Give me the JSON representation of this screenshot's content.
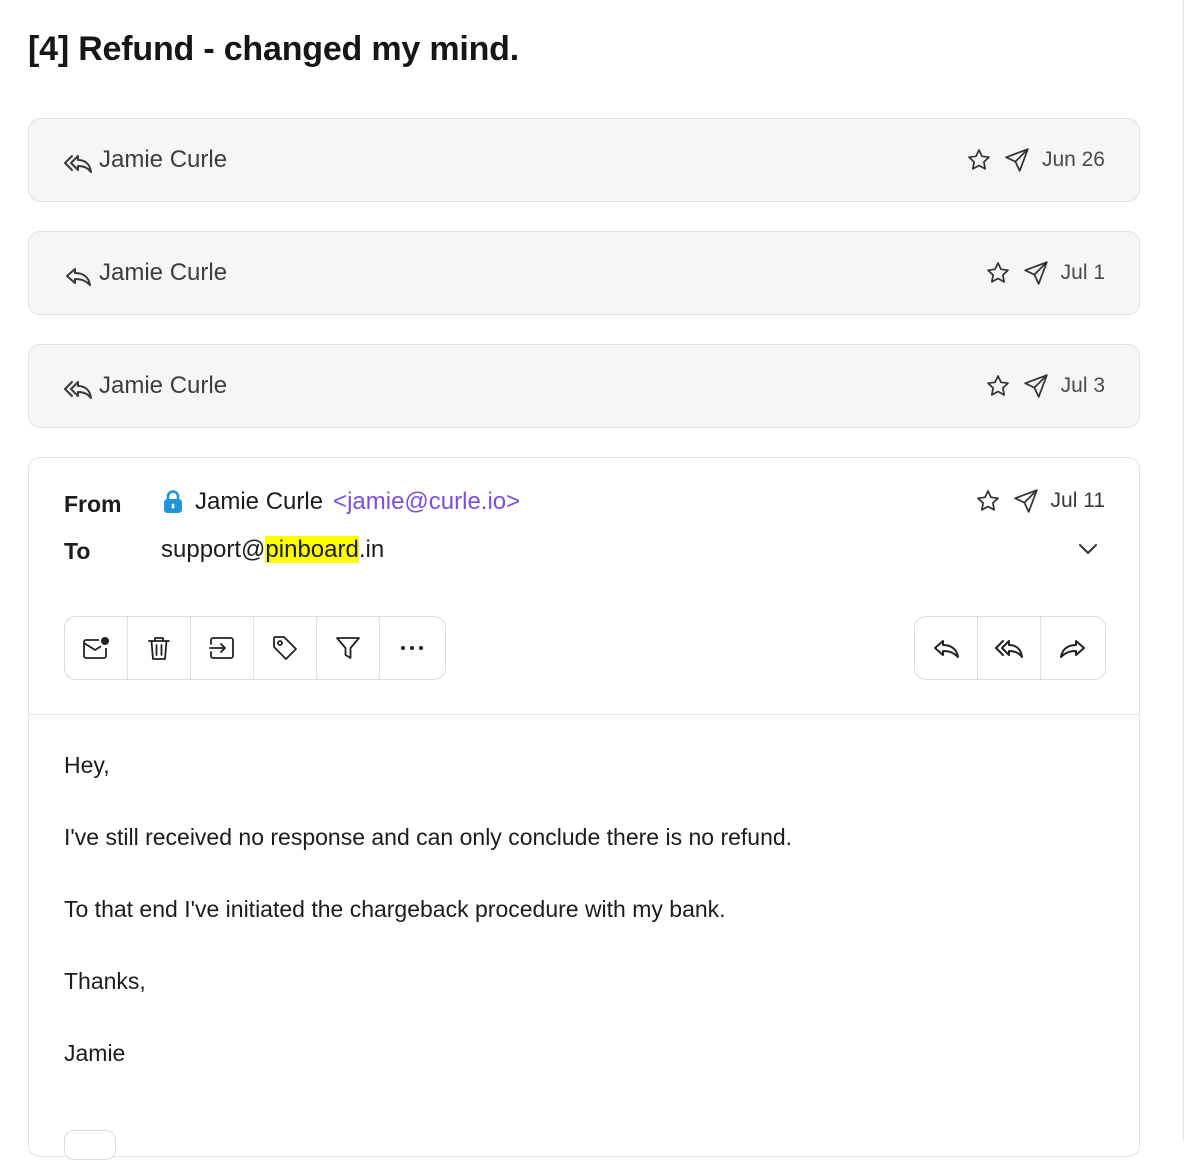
{
  "thread": {
    "subject": "[4] Refund - changed my mind."
  },
  "collapsed_messages": [
    {
      "sender": "Jamie Curle",
      "date": "Jun 26",
      "reply_icon": "reply-all-icon"
    },
    {
      "sender": "Jamie Curle",
      "date": "Jul 1",
      "reply_icon": "reply-icon"
    },
    {
      "sender": "Jamie Curle",
      "date": "Jul 3",
      "reply_icon": "reply-all-icon"
    }
  ],
  "open_message": {
    "from_label": "From",
    "to_label": "To",
    "from_name": "Jamie Curle",
    "from_email": "<jamie@curle.io>",
    "to_prefix": "support@",
    "to_highlight": "pinboard",
    "to_suffix": ".in",
    "date": "Jul 11",
    "body": [
      "Hey,",
      "I've still received no response and can only conclude there is no refund.",
      "To that end I've initiated the chargeback procedure with my bank.",
      "Thanks,",
      "Jamie"
    ]
  },
  "toolbar": {
    "left": [
      "mark-unread-icon",
      "trash-icon",
      "move-to-icon",
      "tag-icon",
      "filter-icon",
      "more-icon"
    ],
    "right": [
      "reply-icon",
      "reply-all-icon",
      "forward-icon"
    ]
  },
  "icons": {
    "star": "star-icon",
    "sent": "sent-icon",
    "lock": "lock-icon",
    "expand": "chevron-down-icon"
  },
  "colors": {
    "email_link": "#7b4fe0",
    "highlight": "#ffff00",
    "lock": "#1d95d8",
    "card_bg": "#f6f6f5"
  }
}
